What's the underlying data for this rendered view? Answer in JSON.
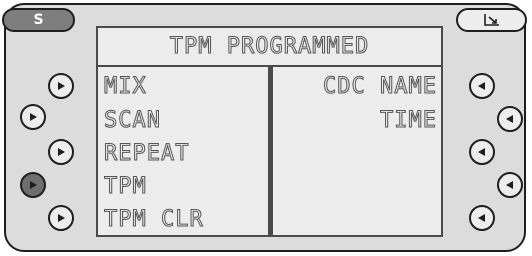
{
  "top_left_button": {
    "label": "S"
  },
  "top_right_button": {
    "icon": "screen-corner-icon"
  },
  "header": {
    "title": "TPM PROGRAMMED"
  },
  "left_menu": {
    "items": [
      {
        "label": "MIX"
      },
      {
        "label": "SCAN"
      },
      {
        "label": "REPEAT"
      },
      {
        "label": "TPM"
      },
      {
        "label": "TPM CLR"
      }
    ]
  },
  "right_menu": {
    "items": [
      {
        "label": "CDC NAME"
      },
      {
        "label": "TIME"
      }
    ]
  },
  "side_buttons": {
    "left": [
      {
        "icon": "arrow-right-icon",
        "active": false
      },
      {
        "icon": "arrow-right-icon",
        "active": false
      },
      {
        "icon": "arrow-right-icon",
        "active": false
      },
      {
        "icon": "arrow-right-icon",
        "active": true
      },
      {
        "icon": "arrow-right-icon",
        "active": false
      }
    ],
    "right": [
      {
        "icon": "arrow-left-icon",
        "active": false
      },
      {
        "icon": "arrow-left-icon",
        "active": false
      },
      {
        "icon": "arrow-left-icon",
        "active": false
      },
      {
        "icon": "arrow-left-icon",
        "active": false
      },
      {
        "icon": "arrow-left-icon",
        "active": false
      }
    ]
  },
  "colors": {
    "bezel": "#dcdcdc",
    "screen": "#ececec",
    "outline": "#1e1e1e",
    "active_button": "#6e6e6e",
    "s_button": "#7e7e7e"
  }
}
